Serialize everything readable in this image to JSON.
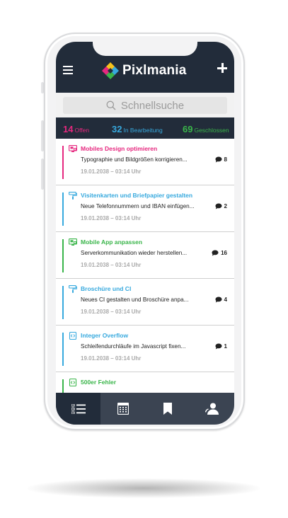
{
  "app": {
    "title": "Pixlmania"
  },
  "search": {
    "placeholder": "Schnellsuche"
  },
  "stats": {
    "open": {
      "count": "14",
      "label": "Offen",
      "color": "#e6287f"
    },
    "in_progress": {
      "count": "32",
      "label": "In Bearbeitung",
      "color": "#37a9de"
    },
    "closed": {
      "count": "69",
      "label": "Geschlossen",
      "color": "#3ab54a"
    }
  },
  "tickets": [
    {
      "title": "Mobiles Design optimieren",
      "desc": "Typographie und Bildgrößen korrigieren...",
      "date": "19.01.2038 – 03:14 Uhr",
      "comments": "8",
      "color": "#e6287f",
      "icon": "monitor-icon"
    },
    {
      "title": "Visitenkarten und Briefpapier gestalten",
      "desc": "Neue Telefonnummern und IBAN einfügen...",
      "date": "19.01.2038 – 03:14 Uhr",
      "comments": "2",
      "color": "#37a9de",
      "icon": "paint-roller-icon"
    },
    {
      "title": "Mobile App anpassen",
      "desc": "Serverkommunikation wieder herstellen...",
      "date": "19.01.2038 – 03:14 Uhr",
      "comments": "16",
      "color": "#3ab54a",
      "icon": "monitor-icon"
    },
    {
      "title": "Broschüre und CI",
      "desc": "Neues CI gestalten und Broschüre anpa...",
      "date": "19.01.2038 – 03:14 Uhr",
      "comments": "4",
      "color": "#37a9de",
      "icon": "paint-roller-icon"
    },
    {
      "title": "Integer Overflow",
      "desc": "Schleifendurchläufe im Javascript fixen...",
      "date": "19.01.2038 – 03:14 Uhr",
      "comments": "1",
      "color": "#37a9de",
      "icon": "code-device-icon"
    },
    {
      "title": "500er Fehler",
      "desc": "",
      "date": "",
      "comments": "",
      "color": "#3ab54a",
      "icon": "code-device-icon"
    }
  ],
  "tabs": [
    {
      "name": "list-view-icon",
      "active": true
    },
    {
      "name": "calendar-icon",
      "active": false
    },
    {
      "name": "bookmark-icon",
      "active": false
    },
    {
      "name": "user-icon",
      "active": false
    }
  ]
}
